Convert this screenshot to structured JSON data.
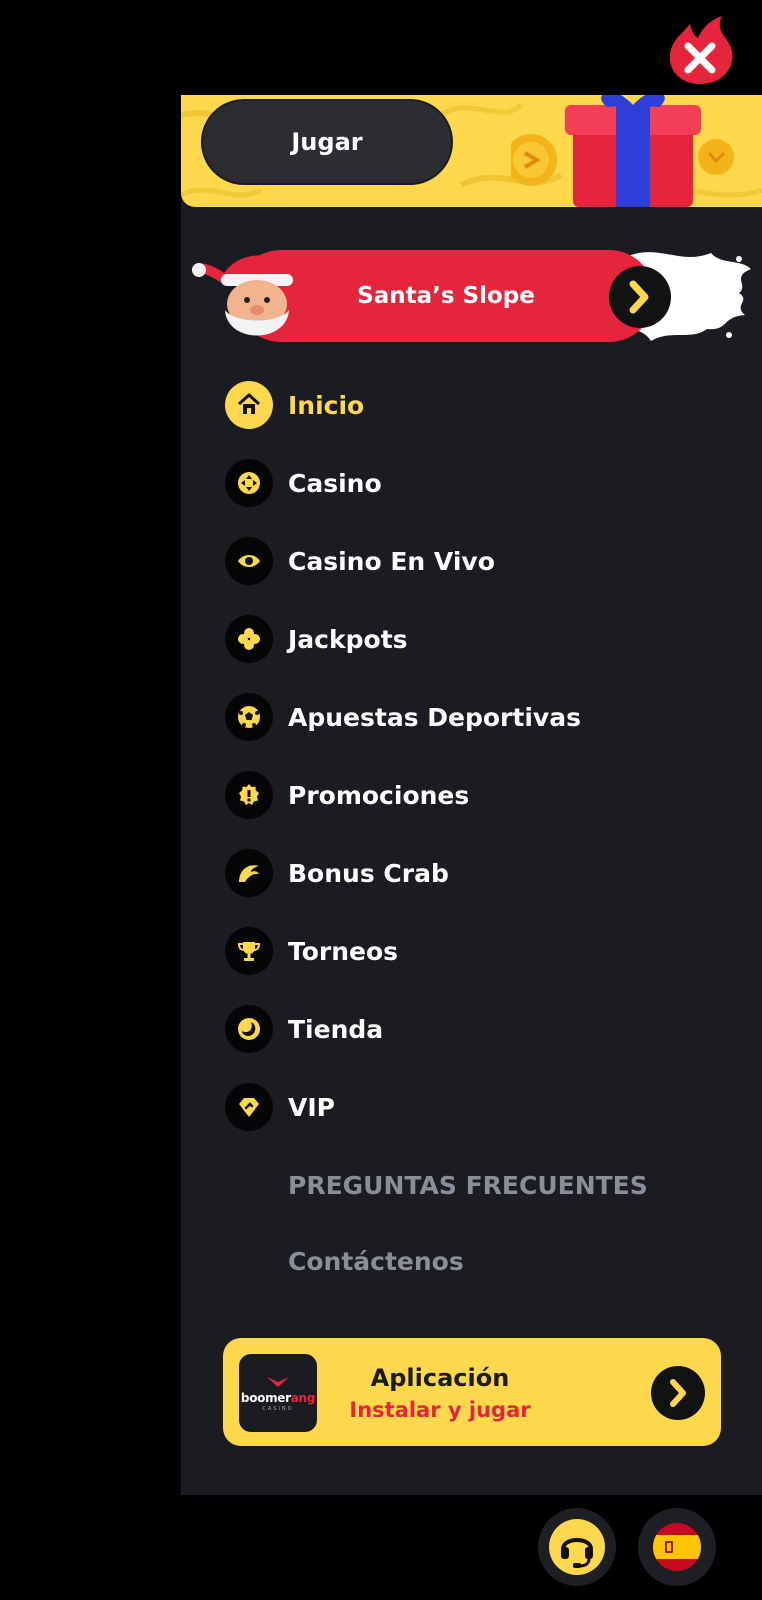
{
  "header": {
    "close_icon": "close-icon",
    "play_label": "Jugar"
  },
  "promo": {
    "label": "Santa’s Slope",
    "icon": "chevron-right-icon"
  },
  "menu": {
    "items": [
      {
        "label": "Inicio",
        "icon": "home-icon",
        "active": true
      },
      {
        "label": "Casino",
        "icon": "dpad-icon"
      },
      {
        "label": "Casino En Vivo",
        "icon": "eye-icon"
      },
      {
        "label": "Jackpots",
        "icon": "clover-icon"
      },
      {
        "label": "Apuestas Deportivas",
        "icon": "soccer-ball-icon"
      },
      {
        "label": "Promociones",
        "icon": "promo-badge-icon"
      },
      {
        "label": "Bonus Crab",
        "icon": "crab-claw-icon"
      },
      {
        "label": "Torneos",
        "icon": "trophy-icon"
      },
      {
        "label": "Tienda",
        "icon": "coin-icon"
      },
      {
        "label": "VIP",
        "icon": "diamond-icon"
      },
      {
        "label": "PREGUNTAS FRECUENTES"
      },
      {
        "label": "Contáctenos"
      }
    ]
  },
  "app_banner": {
    "logo_text_prefix": "boomer",
    "logo_text_suffix": "ang",
    "logo_subtext": "CASINO",
    "title": "Aplicación",
    "subtitle": "Instalar y jugar"
  },
  "footer": {
    "support_icon": "headset-icon",
    "language_icon": "spain-flag-icon"
  },
  "colors": {
    "accent": "#fdd84d",
    "brand_red": "#e5253d",
    "panel": "#1b1c21",
    "muted_text": "#8c8d9b"
  }
}
